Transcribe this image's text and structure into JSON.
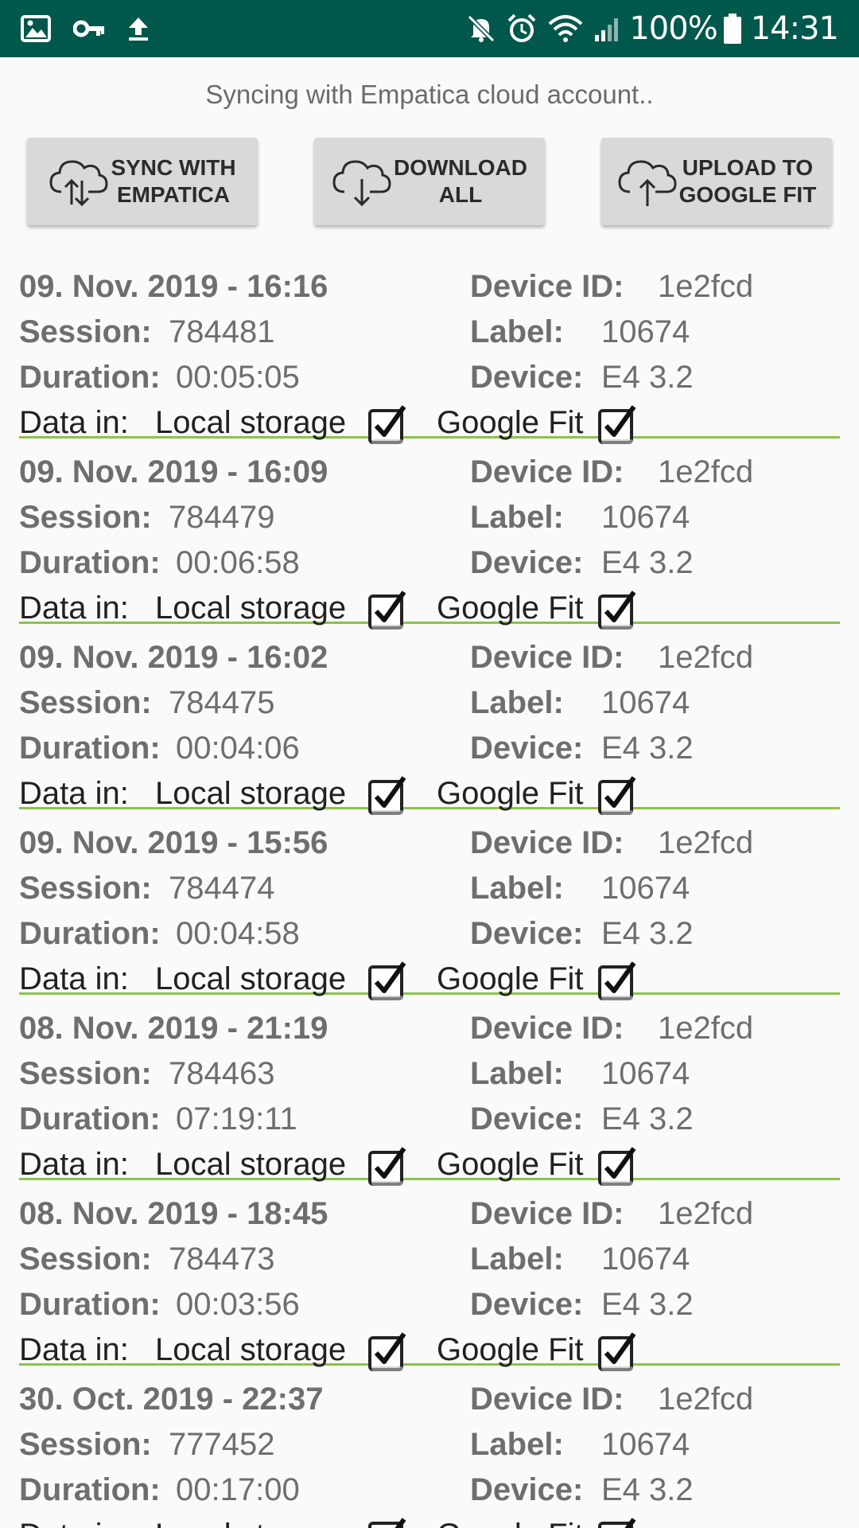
{
  "status_bar": {
    "battery_percent": "100%",
    "time": "14:31"
  },
  "sync_status": "Syncing with Empatica cloud account..",
  "buttons": {
    "sync": "SYNC WITH\nEMPATICA",
    "download": "DOWNLOAD\nALL",
    "upload": "UPLOAD TO\nGOOGLE FIT"
  },
  "labels": {
    "device_id": "Device ID:",
    "session": "Session:",
    "label": "Label:",
    "duration": "Duration:",
    "device": "Device:",
    "data_in": "Data in:",
    "local_storage": "Local storage",
    "google_fit": "Google Fit"
  },
  "sessions": [
    {
      "datetime": "09. Nov. 2019 - 16:16",
      "session": "784481",
      "duration": "00:05:05",
      "device_id": "1e2fcd",
      "label": "10674",
      "device": "E4 3.2",
      "local_storage": true,
      "google_fit": true
    },
    {
      "datetime": "09. Nov. 2019 - 16:09",
      "session": "784479",
      "duration": "00:06:58",
      "device_id": "1e2fcd",
      "label": "10674",
      "device": "E4 3.2",
      "local_storage": true,
      "google_fit": true
    },
    {
      "datetime": "09. Nov. 2019 - 16:02",
      "session": "784475",
      "duration": "00:04:06",
      "device_id": "1e2fcd",
      "label": "10674",
      "device": "E4 3.2",
      "local_storage": true,
      "google_fit": true
    },
    {
      "datetime": "09. Nov. 2019 - 15:56",
      "session": "784474",
      "duration": "00:04:58",
      "device_id": "1e2fcd",
      "label": "10674",
      "device": "E4 3.2",
      "local_storage": true,
      "google_fit": true
    },
    {
      "datetime": "08. Nov. 2019 - 21:19",
      "session": "784463",
      "duration": "07:19:11",
      "device_id": "1e2fcd",
      "label": "10674",
      "device": "E4 3.2",
      "local_storage": true,
      "google_fit": true
    },
    {
      "datetime": "08. Nov. 2019 - 18:45",
      "session": "784473",
      "duration": "00:03:56",
      "device_id": "1e2fcd",
      "label": "10674",
      "device": "E4 3.2",
      "local_storage": true,
      "google_fit": true
    },
    {
      "datetime": "30. Oct. 2019 - 22:37",
      "session": "777452",
      "duration": "00:17:00",
      "device_id": "1e2fcd",
      "label": "10674",
      "device": "E4 3.2",
      "local_storage": true,
      "google_fit": true
    }
  ]
}
